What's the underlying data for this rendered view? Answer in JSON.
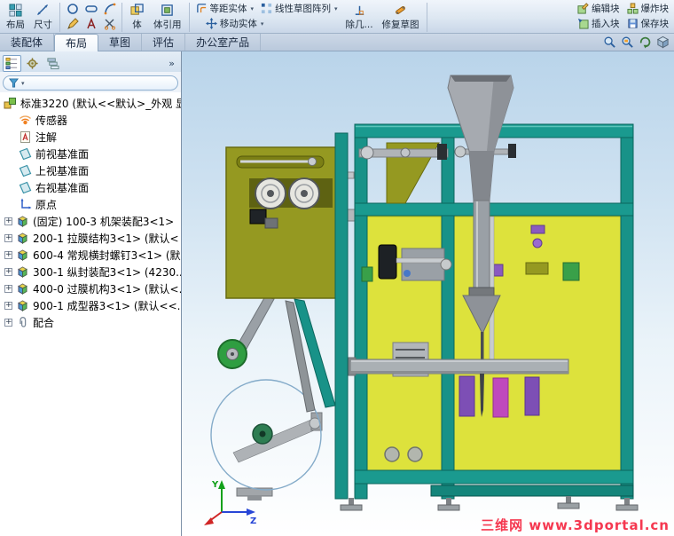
{
  "glyphs": {
    "plus": "+",
    "caret": "▾"
  },
  "colors": {
    "frame_teal": "#189288",
    "panel_yellow": "#dde23c",
    "plate_olive": "#959921",
    "funnel_gray": "#a6aab0",
    "accent_purple": "#7d4fb5",
    "accent_magenta": "#bf49bd",
    "roller_green": "#2f9e41",
    "watermark_red": "#f53850",
    "viewport_top_blue": "#b9d4ea"
  },
  "toolbar": {
    "buttons": {
      "layout": "布局",
      "dimension": "尺寸",
      "convert1": "体",
      "convert2": "体引用",
      "offset": "等距实体",
      "linear_pattern": "线性草图阵列",
      "move": "移动实体",
      "relations": "除几...",
      "repair": "修复草图",
      "edit_block": "编辑块",
      "insert_block": "插入块",
      "explode_block": "爆炸块",
      "save_block": "保存块"
    }
  },
  "tabs": {
    "active_tab": "布局",
    "items": [
      {
        "label": "装配体"
      },
      {
        "label": "布局"
      },
      {
        "label": "草图"
      },
      {
        "label": "评估"
      },
      {
        "label": "办公室产品"
      }
    ]
  },
  "panel": {
    "flyout": "»",
    "tree": {
      "items": [
        {
          "label": "标准3220 (默认<<默认>_外观 显",
          "icon": "assembly"
        },
        {
          "label": "传感器",
          "icon": "sensor"
        },
        {
          "label": "注解",
          "icon": "annotations"
        },
        {
          "label": "前视基准面",
          "icon": "plane"
        },
        {
          "label": "上视基准面",
          "icon": "plane"
        },
        {
          "label": "右视基准面",
          "icon": "plane"
        },
        {
          "label": "原点",
          "icon": "origin"
        },
        {
          "label": "(固定) 100-3 机架装配3<1>",
          "icon": "component",
          "expandable": true
        },
        {
          "label": "200-1 拉膜结构3<1> (默认<",
          "icon": "component",
          "expandable": true
        },
        {
          "label": "600-4 常规横封螺钉3<1> (默...",
          "icon": "component",
          "expandable": true
        },
        {
          "label": "300-1 纵封装配3<1> (4230...",
          "icon": "component",
          "expandable": true
        },
        {
          "label": "400-0 过膜机构3<1> (默认<...",
          "icon": "component",
          "expandable": true
        },
        {
          "label": "900-1 成型器3<1> (默认<<...",
          "icon": "component",
          "expandable": true
        },
        {
          "label": "配合",
          "icon": "mates",
          "expandable": true
        }
      ]
    }
  },
  "viewport": {
    "watermark": "三维网 www.3dportal.cn",
    "axes": {
      "y": "Y",
      "z": "Z"
    }
  }
}
